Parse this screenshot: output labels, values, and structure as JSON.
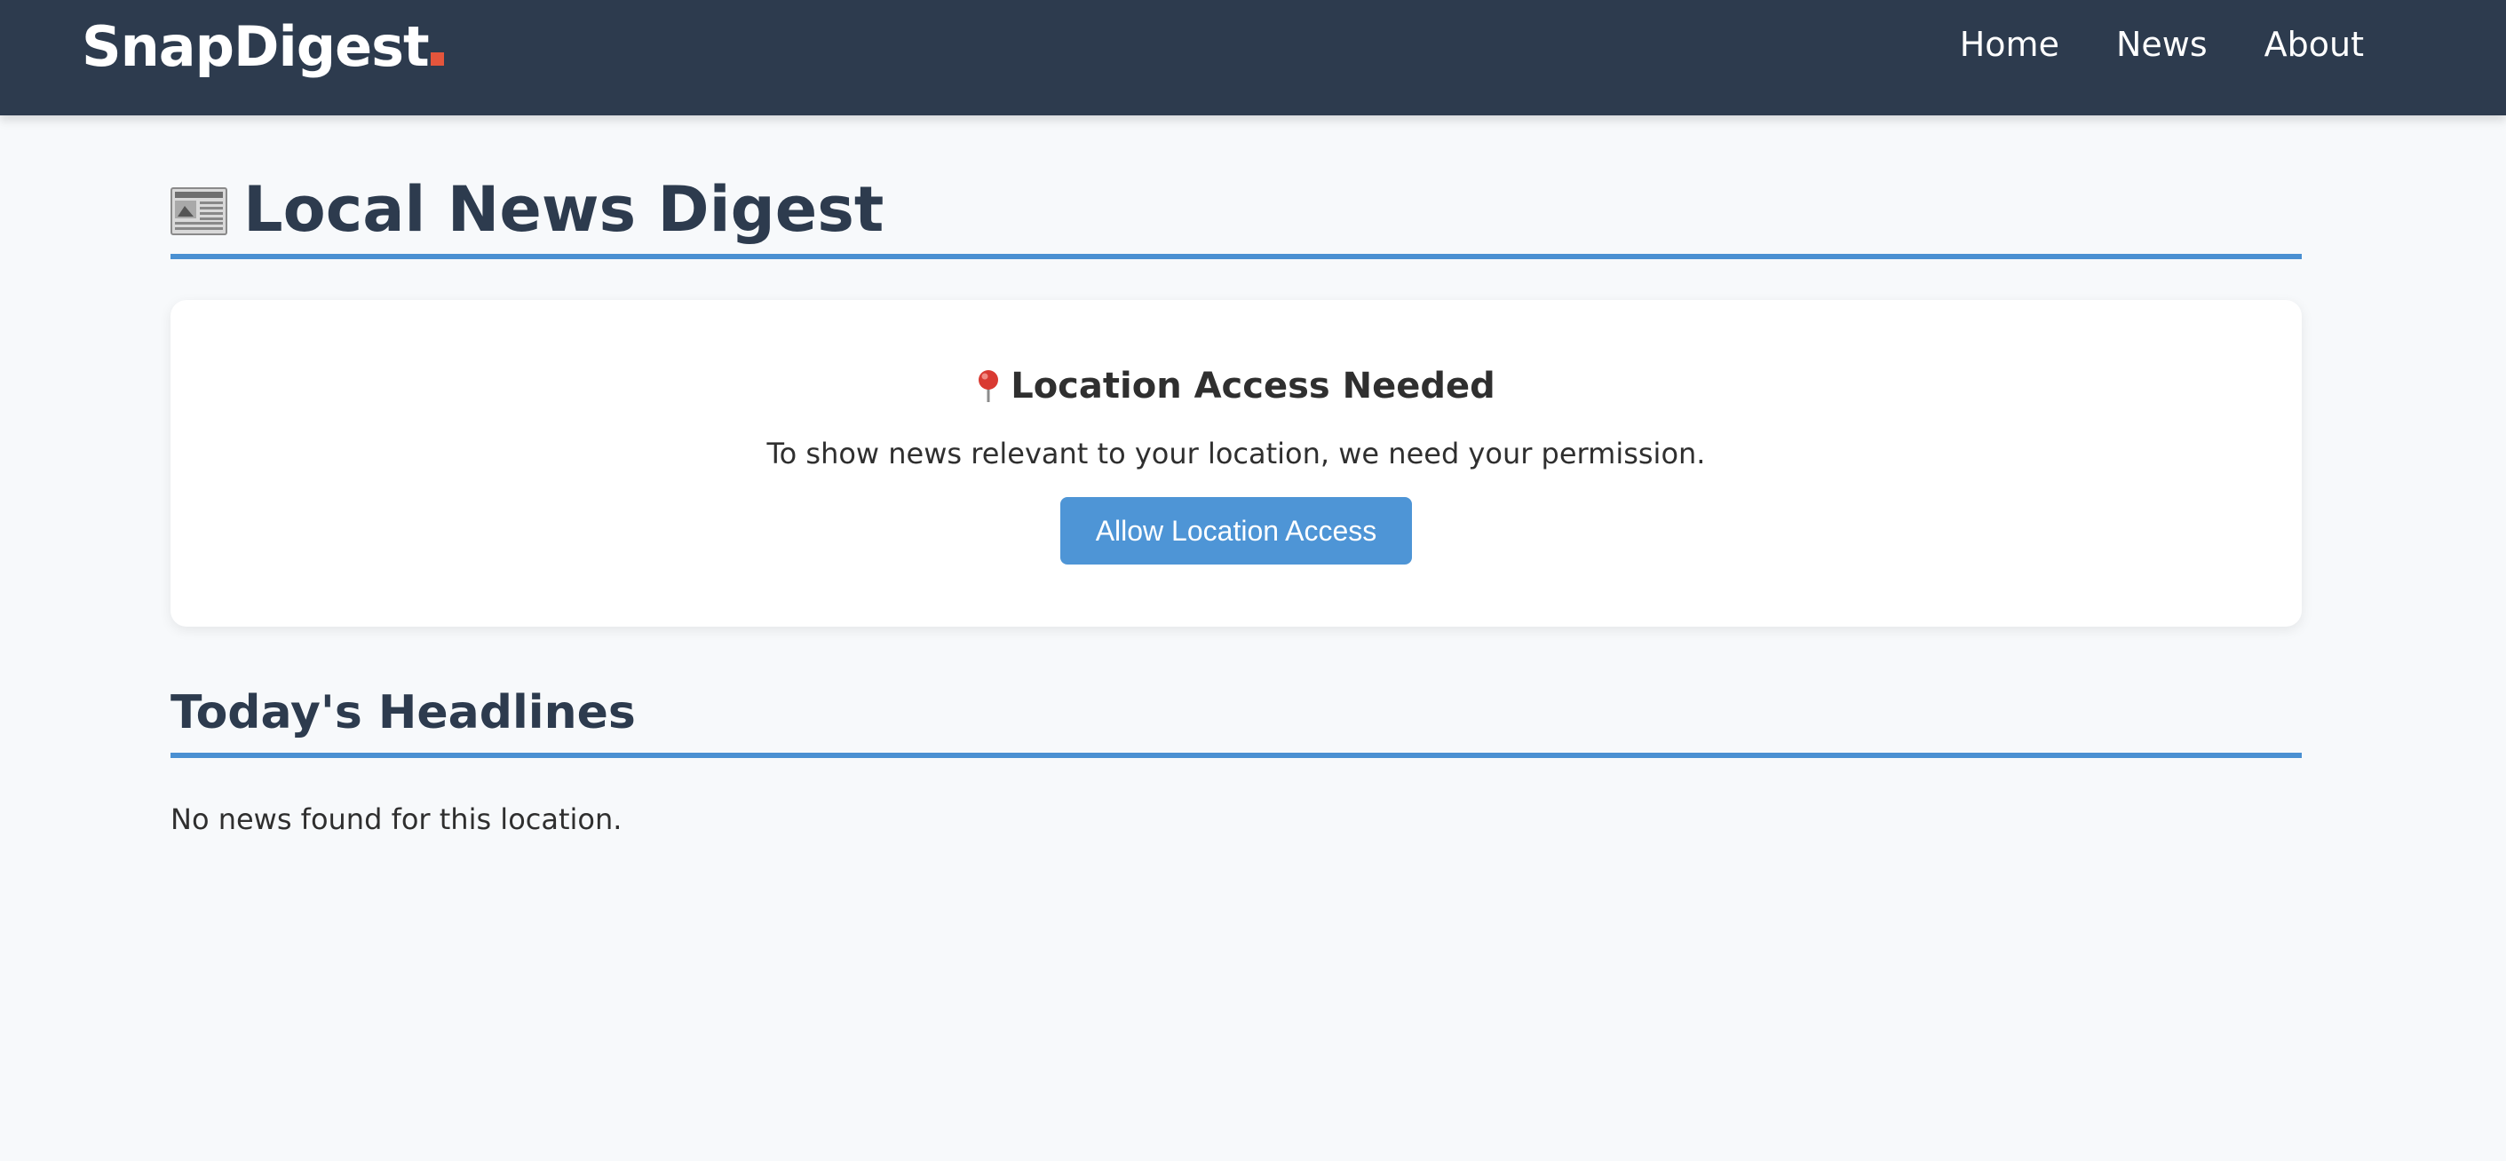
{
  "header": {
    "brand": "SnapDigest",
    "brand_dot_color": "#e4553c",
    "nav": [
      {
        "label": "Home"
      },
      {
        "label": "News"
      },
      {
        "label": "About"
      }
    ]
  },
  "main": {
    "title": "Local News Digest",
    "title_icon": "newspaper-icon",
    "location_card": {
      "icon": "pin-icon",
      "title": "Location Access Needed",
      "message": "To show news relevant to your location, we need your permission.",
      "button_label": "Allow Location Access"
    },
    "headlines": {
      "title": "Today's Headlines",
      "empty_message": "No news found for this location."
    }
  },
  "colors": {
    "header_bg": "#2d3b4e",
    "accent": "#4a90d2",
    "button": "#4e95d6",
    "page_bg": "#f7f9fb"
  }
}
